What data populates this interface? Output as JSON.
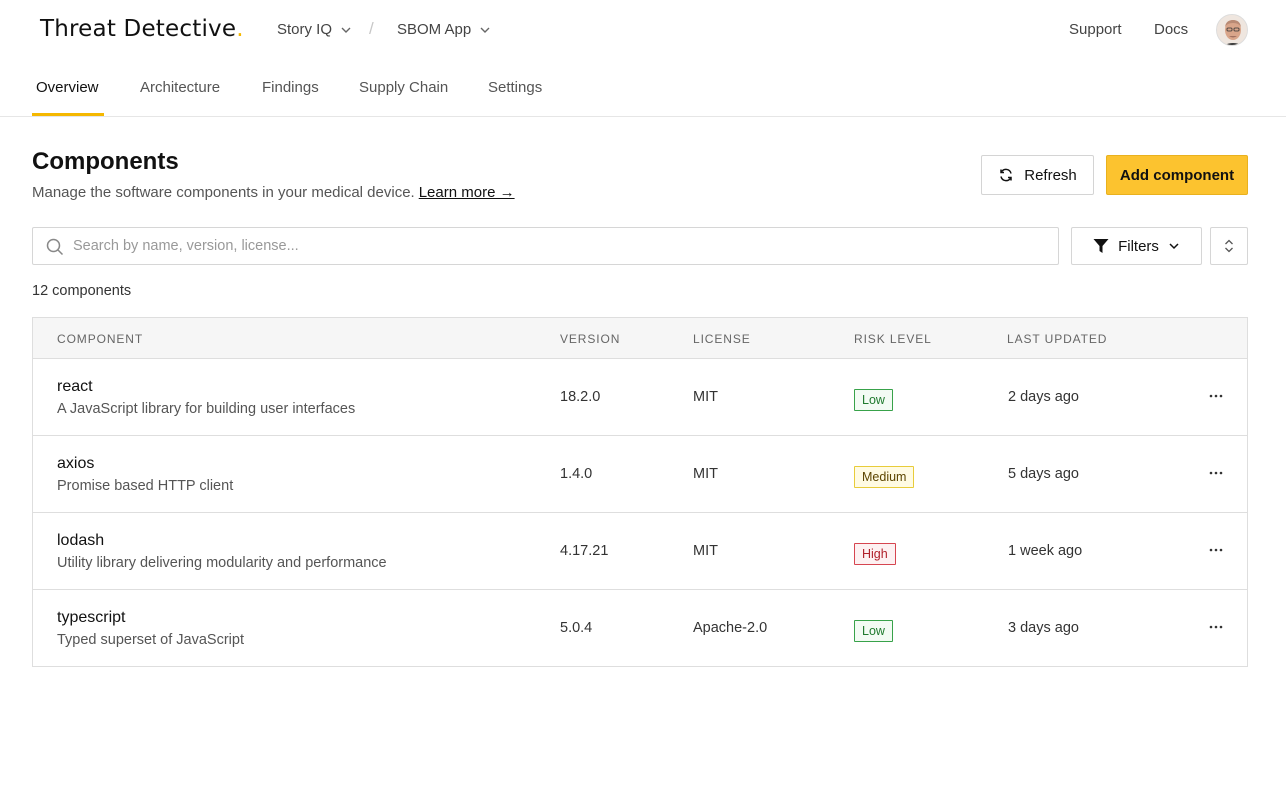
{
  "header": {
    "logo": "Threat Detective",
    "logo_dot": ".",
    "breadcrumbs": [
      {
        "label": "Story IQ"
      },
      {
        "label": "SBOM App"
      }
    ],
    "separator": "/",
    "links": {
      "support": "Support",
      "docs": "Docs"
    }
  },
  "tabs": [
    {
      "label": "Overview",
      "active": true
    },
    {
      "label": "Architecture",
      "active": false
    },
    {
      "label": "Findings",
      "active": false
    },
    {
      "label": "Supply Chain",
      "active": false
    },
    {
      "label": "Settings",
      "active": false
    }
  ],
  "page": {
    "title": "Components",
    "subtitle": "Manage the software components in your medical device.",
    "learn_more": "Learn more →",
    "refresh_label": "Refresh",
    "add_label": "Add component"
  },
  "search": {
    "placeholder": "Search by name, version, license..."
  },
  "filters_label": "Filters",
  "count_text": "12 components",
  "table": {
    "columns": [
      "COMPONENT",
      "VERSION",
      "LICENSE",
      "RISK LEVEL",
      "LAST UPDATED"
    ],
    "rows": [
      {
        "name": "react",
        "description": "A JavaScript library for building user interfaces",
        "version": "18.2.0",
        "license": "MIT",
        "risk": "Low",
        "updated": "2 days ago"
      },
      {
        "name": "axios",
        "description": "Promise based HTTP client",
        "version": "1.4.0",
        "license": "MIT",
        "risk": "Medium",
        "updated": "5 days ago"
      },
      {
        "name": "lodash",
        "description": "Utility library delivering modularity and performance",
        "version": "4.17.21",
        "license": "MIT",
        "risk": "High",
        "updated": "1 week ago"
      },
      {
        "name": "typescript",
        "description": "Typed superset of JavaScript",
        "version": "5.0.4",
        "license": "Apache-2.0",
        "risk": "Low",
        "updated": "3 days ago"
      }
    ]
  },
  "colors": {
    "accent": "#fcc32f",
    "low": "#38a24a",
    "medium": "#e8cc3a",
    "high": "#d64550"
  }
}
